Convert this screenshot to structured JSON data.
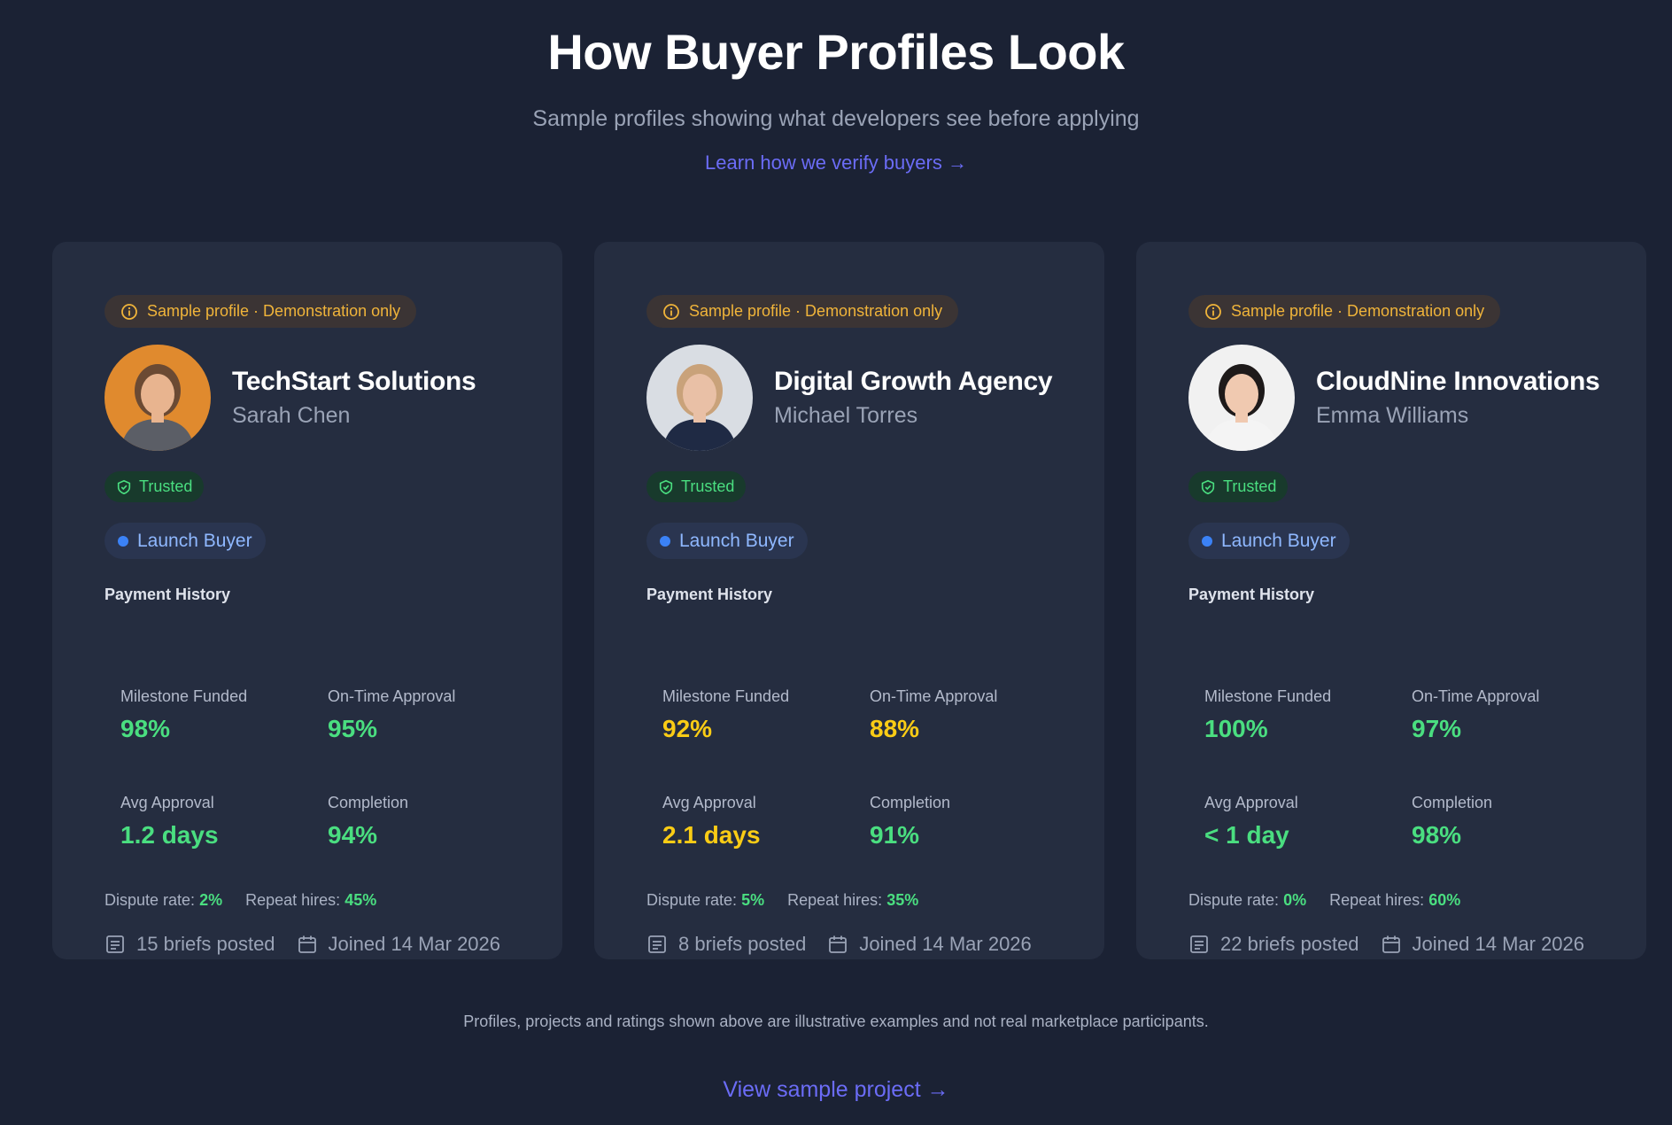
{
  "header": {
    "title": "How Buyer Profiles Look",
    "subtitle": "Sample profiles showing what developers see before applying",
    "link": "Learn how we verify buyers →"
  },
  "colors": {
    "background": "#1b2234",
    "card": "#252d40",
    "accent_link": "#6b6cf6",
    "sample_pill_text": "#f0b43a",
    "trusted_green": "#4ade80",
    "stat_green": "#4ade80",
    "stat_yellow": "#facc15",
    "tier_blue": "#3b82f6"
  },
  "cards": [
    {
      "sample_label": "Sample profile · Demonstration only",
      "company": "TechStart Solutions",
      "person": "Sarah Chen",
      "trusted_label": "Trusted",
      "tier_label": "Launch Buyer",
      "section_label": "Payment History",
      "stats": [
        {
          "label": "Milestone Funded",
          "value": "98%",
          "tone": "green"
        },
        {
          "label": "On-Time Approval",
          "value": "95%",
          "tone": "green"
        },
        {
          "label": "Avg Approval",
          "value": "1.2 days",
          "tone": "green"
        },
        {
          "label": "Completion",
          "value": "94%",
          "tone": "green"
        }
      ],
      "dispute_label": "Dispute rate:",
      "dispute_value": "2%",
      "repeat_label": "Repeat hires:",
      "repeat_value": "45%",
      "briefs": "15 briefs posted",
      "joined": "Joined 14 Mar 2026",
      "avatar": {
        "skin": "#e8b48f",
        "hair": "#6b4a33",
        "shirt": "#5b5e66",
        "bg": "#e08a2e"
      }
    },
    {
      "sample_label": "Sample profile · Demonstration only",
      "company": "Digital Growth Agency",
      "person": "Michael Torres",
      "trusted_label": "Trusted",
      "tier_label": "Launch Buyer",
      "section_label": "Payment History",
      "stats": [
        {
          "label": "Milestone Funded",
          "value": "92%",
          "tone": "yellow"
        },
        {
          "label": "On-Time Approval",
          "value": "88%",
          "tone": "yellow"
        },
        {
          "label": "Avg Approval",
          "value": "2.1 days",
          "tone": "yellow"
        },
        {
          "label": "Completion",
          "value": "91%",
          "tone": "green"
        }
      ],
      "dispute_label": "Dispute rate:",
      "dispute_value": "5%",
      "repeat_label": "Repeat hires:",
      "repeat_value": "35%",
      "briefs": "8 briefs posted",
      "joined": "Joined 14 Mar 2026",
      "avatar": {
        "skin": "#e9c0a6",
        "hair": "#c9a27a",
        "shirt": "#1f2a44",
        "bg": "#d9dde3"
      }
    },
    {
      "sample_label": "Sample profile · Demonstration only",
      "company": "CloudNine Innovations",
      "person": "Emma Williams",
      "trusted_label": "Trusted",
      "tier_label": "Launch Buyer",
      "section_label": "Payment History",
      "stats": [
        {
          "label": "Milestone Funded",
          "value": "100%",
          "tone": "green"
        },
        {
          "label": "On-Time Approval",
          "value": "97%",
          "tone": "green"
        },
        {
          "label": "Avg Approval",
          "value": "< 1 day",
          "tone": "green"
        },
        {
          "label": "Completion",
          "value": "98%",
          "tone": "green"
        }
      ],
      "dispute_label": "Dispute rate:",
      "dispute_value": "0%",
      "repeat_label": "Repeat hires:",
      "repeat_value": "60%",
      "briefs": "22 briefs posted",
      "joined": "Joined 14 Mar 2026",
      "avatar": {
        "skin": "#f0c9b0",
        "hair": "#1e1a1a",
        "shirt": "#f4f4f4",
        "bg": "#f1f1f1"
      }
    }
  ],
  "footer": {
    "disclaimer": "Profiles, projects and ratings shown above are illustrative examples and not real marketplace participants.",
    "link": "View sample project →"
  }
}
